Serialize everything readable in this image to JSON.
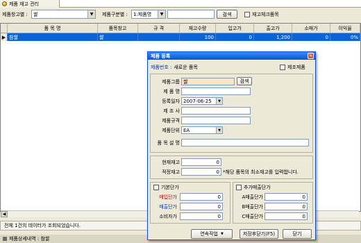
{
  "tab": {
    "icon": "coin-icon",
    "label": "제품 재고 관리"
  },
  "filter": {
    "warehouse_label": "제품창고별 :",
    "warehouse_value": "쌀",
    "category_label": "제품구분별 :",
    "category_value": "1:제품명",
    "search_value": "",
    "search_button": "검색",
    "stock_check_label": "재고체크품목"
  },
  "grid": {
    "columns": [
      "품 목 명",
      "품목창고",
      "규 격",
      "재고수량",
      "입고가",
      "출고가",
      "소매가",
      "이익율"
    ],
    "rows": [
      {
        "name": "참쌀",
        "warehouse": "쌀",
        "spec": "",
        "qty": "100",
        "in_price": "0",
        "out_price": "1,200",
        "retail": "0",
        "margin": "0%"
      }
    ]
  },
  "status_text": "전체 1건의 데이터가 조회되었습니다.",
  "bottom_label": "제품상세내역 : 참쌀",
  "dialog": {
    "title": "제품 등록",
    "product_no_label": "제품번호 :",
    "product_no_value": "새로운 품목",
    "manufactured_label": "제조제품",
    "group_label": "제품그룹",
    "group_value": "쌀",
    "group_search": "검색",
    "name_label": "제 품 명",
    "name_value": "",
    "date_label": "등록일자",
    "date_value": "2007-06-25",
    "maker_label": "제 조 사",
    "maker_value": "",
    "spec_label": "제품규격",
    "spec_value": "",
    "unit_label": "제품단위",
    "unit_value": "EA",
    "desc_label": "품 목 설 명",
    "desc_value": "",
    "current_stock_label": "현재재고",
    "current_stock_value": "0",
    "safety_stock_label": "적정재고",
    "safety_stock_value": "0",
    "safety_stock_hint": "*해당 품목의 최소재고를 입력합니다.",
    "base_price_label": "기본단가",
    "purchase_label": "매입단가",
    "purchase_value": "0",
    "sale_label": "매출단가",
    "sale_value": "0",
    "consumer_label": "소비자가",
    "consumer_value": "0",
    "extra_price_label": "추가매출단가",
    "a_label": "A매출단가",
    "a_value": "0",
    "b_label": "B매출단가",
    "b_value": "0",
    "c_label": "C매출단가",
    "c_value": "0",
    "continuous_button": "연속작업",
    "save_close_button": "저장후닫기(F5)",
    "close_button": "닫기"
  },
  "colors": {
    "title_blue": "#0a53d8",
    "selection": "#0a64d6",
    "red_label": "#cc0000",
    "blue_label": "#0033cc"
  }
}
